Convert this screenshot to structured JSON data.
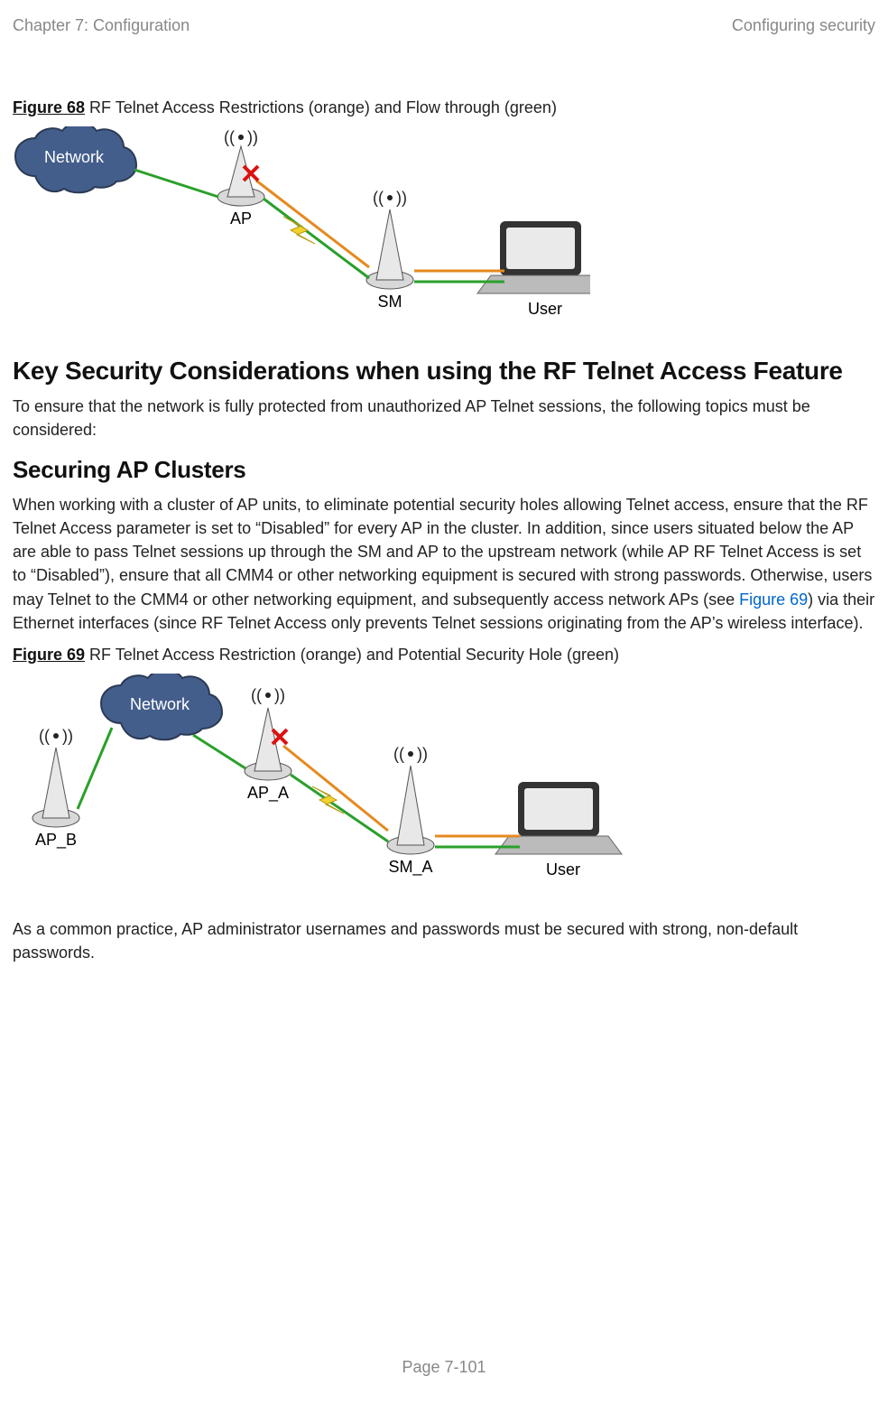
{
  "header": {
    "left": "Chapter 7:  Configuration",
    "right": "Configuring security"
  },
  "figure68": {
    "label": "Figure 68",
    "caption_rest": " RF Telnet Access Restrictions (orange) and Flow through (green)",
    "labels": {
      "network": "Network",
      "ap": "AP",
      "sm": "SM",
      "user": "User"
    }
  },
  "heading1": "Key Security Considerations when using the RF Telnet Access Feature",
  "para1": "To ensure that the network is fully protected from unauthorized AP Telnet sessions, the following topics must be considered:",
  "heading2": "Securing AP Clusters",
  "para2_pre": "When working with a cluster of AP units, to eliminate potential security holes allowing Telnet access, ensure that the RF Telnet Access parameter is set to “Disabled” for every AP in the cluster. In addition, since users situated below the AP are able to pass Telnet sessions up through the SM and AP to the upstream network (while AP RF Telnet Access is set to “Disabled”), ensure that all CMM4 or other networking equipment is secured with strong passwords. Otherwise, users may Telnet to the CMM4 or other networking equipment, and subsequently access network APs (see ",
  "para2_link": "Figure 69",
  "para2_post": ") via their Ethernet interfaces (since RF Telnet Access only prevents Telnet sessions originating from the AP’s wireless interface).",
  "figure69": {
    "label": "Figure 69",
    "caption_rest": " RF Telnet Access Restriction (orange) and Potential Security Hole (green)",
    "labels": {
      "network": "Network",
      "ap_a": "AP_A",
      "ap_b": "AP_B",
      "sm_a": "SM_A",
      "user": "User"
    }
  },
  "para3": "As a common practice, AP administrator usernames and passwords must be secured with strong, non-default passwords.",
  "footer": "Page 7-101"
}
